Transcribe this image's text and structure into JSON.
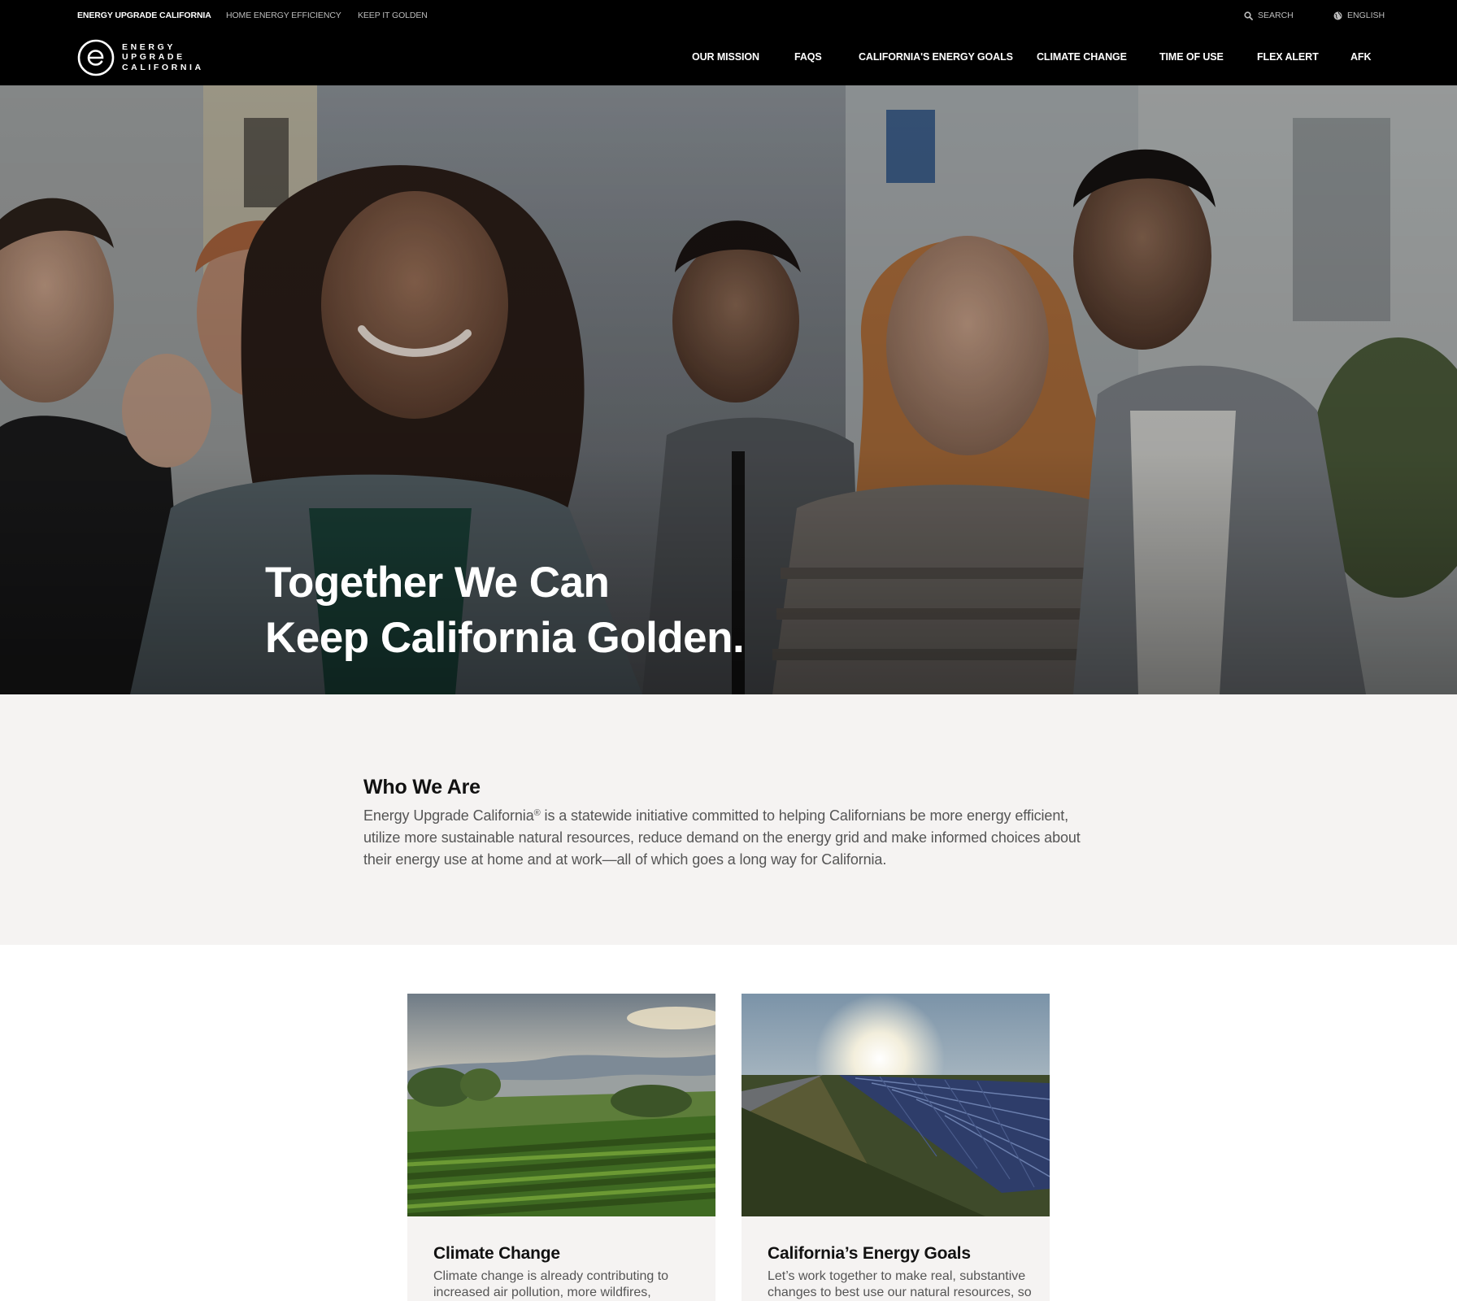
{
  "utility_nav": {
    "links": [
      {
        "label": "ENERGY UPGRADE CALIFORNIA",
        "active": true
      },
      {
        "label": "HOME ENERGY EFFICIENCY",
        "active": false
      },
      {
        "label": "KEEP IT GOLDEN",
        "active": false
      }
    ],
    "search_label": "SEARCH",
    "search_icon": "search-icon",
    "language_label": "ENGLISH",
    "language_icon": "globe-icon"
  },
  "logo": {
    "lines": [
      "ENERGY",
      "UPGRADE",
      "CALIFORNIA"
    ]
  },
  "main_nav": {
    "items": [
      {
        "label": "OUR MISSION"
      },
      {
        "label": "FAQS"
      },
      {
        "label": "CALIFORNIA'S ENERGY GOALS"
      },
      {
        "label": "CLIMATE CHANGE"
      },
      {
        "label": "TIME OF USE"
      },
      {
        "label": "FLEX ALERT"
      },
      {
        "label": "AFK"
      }
    ]
  },
  "hero": {
    "title_line1": "Together We Can",
    "title_line2": "Keep California Golden."
  },
  "who_we_are": {
    "heading": "Who We Are",
    "body_brand": "Energy Upgrade California",
    "body_reg": "®",
    "body_rest": " is a statewide initiative committed to helping Californians be more energy efficient, utilize more sustainable natural resources, reduce demand on the energy grid and make informed choices about their energy use at home and at work—all of which goes a long way for California."
  },
  "cards": [
    {
      "title": "Climate Change",
      "text": "Climate change is already contributing to increased air pollution, more wildfires,"
    },
    {
      "title": "California’s Energy Goals",
      "text": "Let’s work together to make real, substantive changes to best use our natural resources, so"
    }
  ],
  "colors": {
    "header_bg": "#000000",
    "section_bg": "#f5f3f2",
    "text_dark": "#111111",
    "text_body": "#555555"
  }
}
